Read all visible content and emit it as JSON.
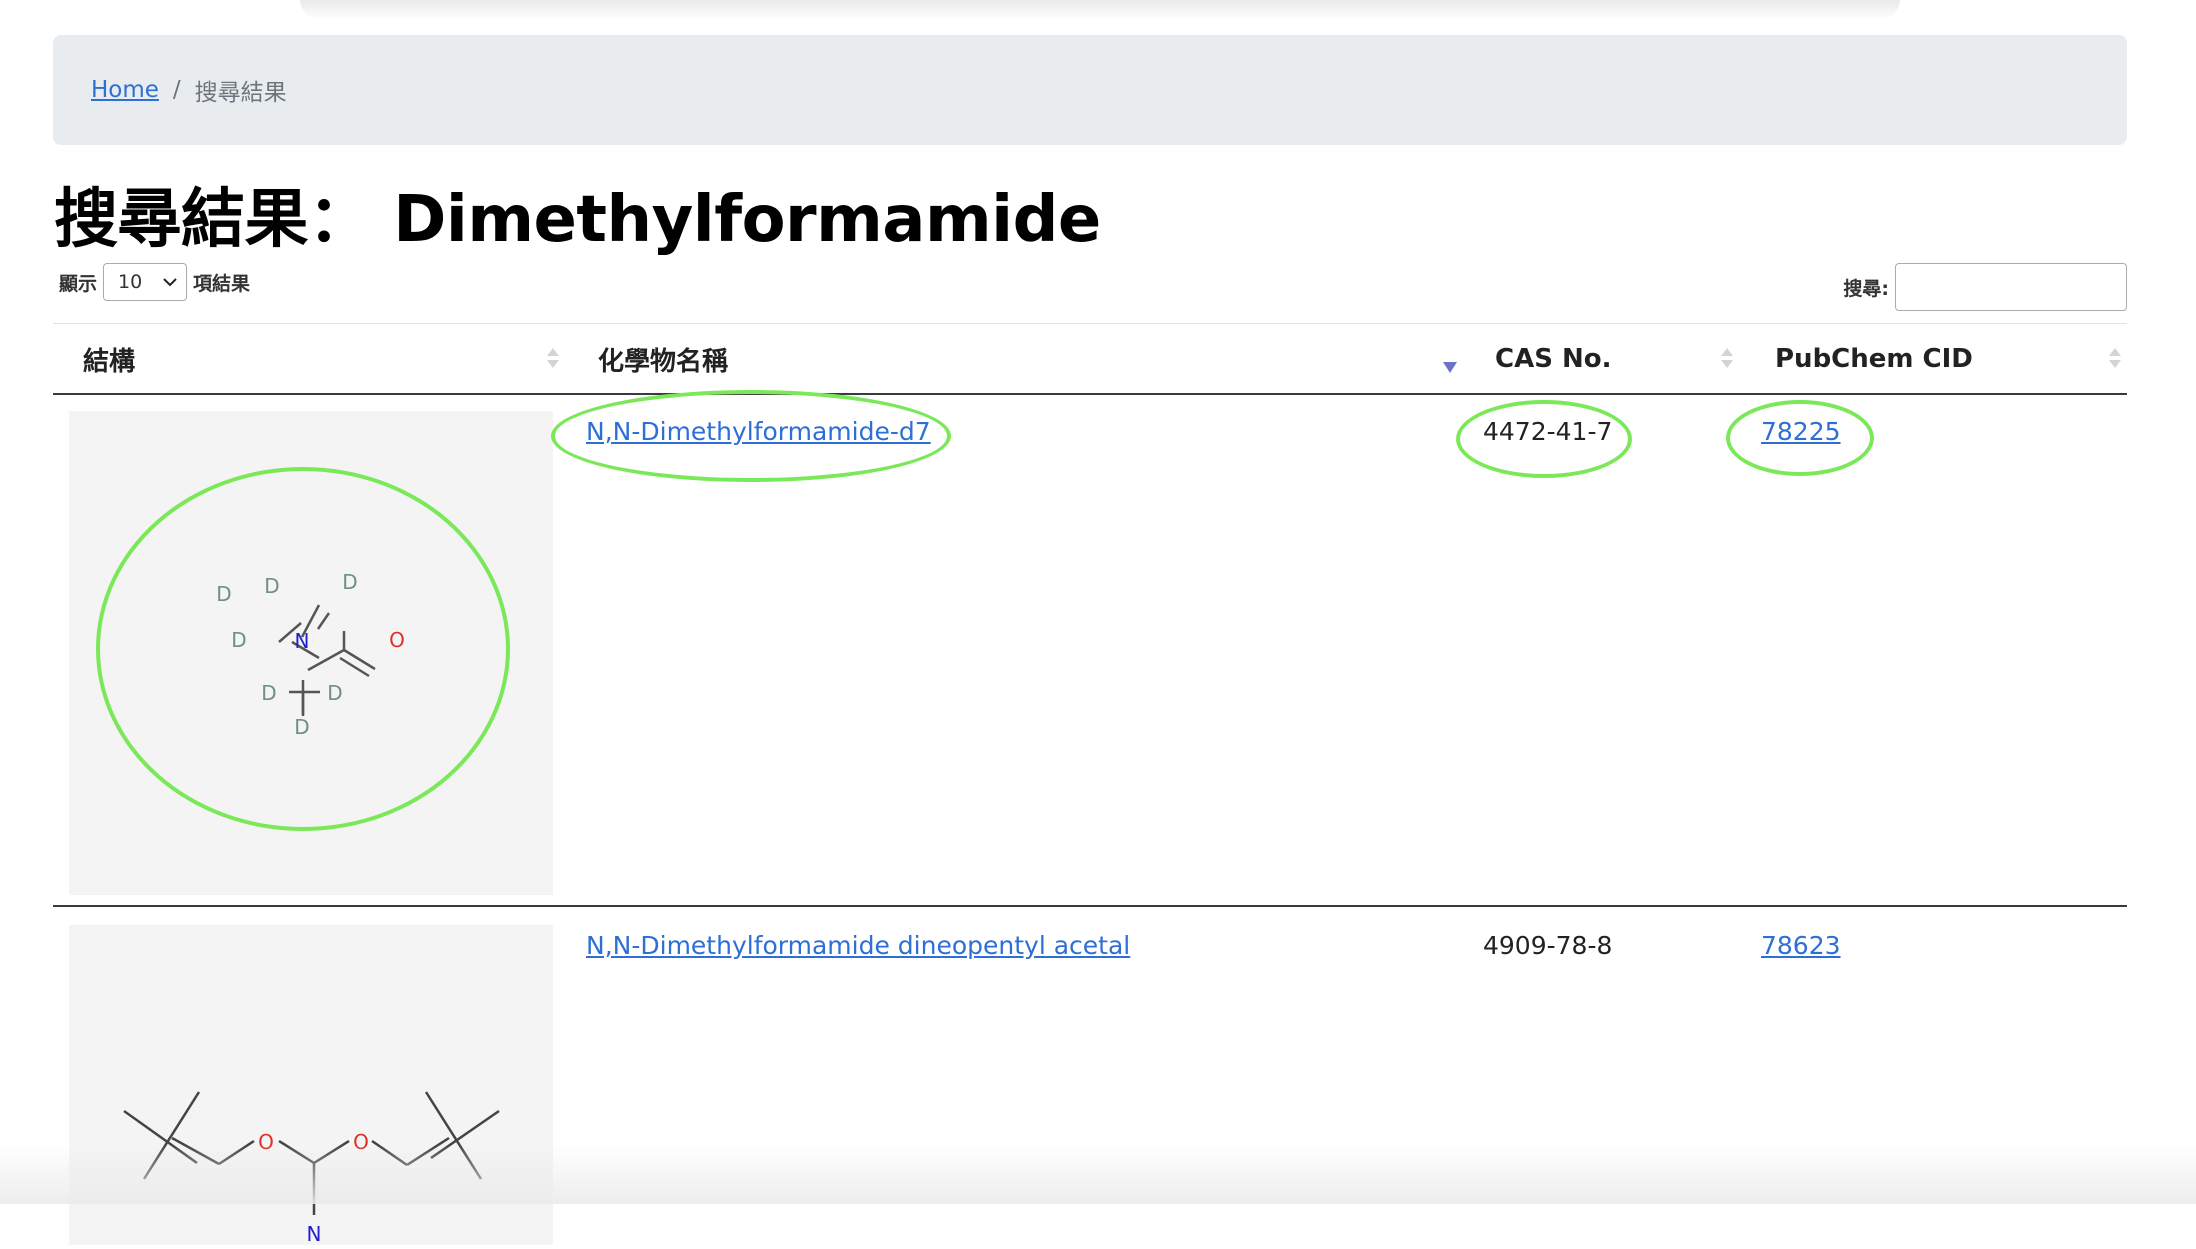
{
  "breadcrumb": {
    "home": "Home",
    "separator": "/",
    "current": "搜尋結果"
  },
  "page_title": "搜尋結果： Dimethylformamide",
  "length_control": {
    "prefix": "顯示",
    "selected": "10",
    "suffix": "項結果"
  },
  "search_control": {
    "label": "搜尋:",
    "value": ""
  },
  "table": {
    "columns": [
      "結構",
      "化學物名稱",
      "CAS No.",
      "PubChem CID"
    ],
    "sorted_column": "化學物名稱",
    "rows": [
      {
        "name": "N,N-Dimethylformamide-d7",
        "cas": "4472-41-7",
        "cid": "78225",
        "structure_atoms": [
          "D",
          "D",
          "D",
          "D",
          "D",
          "D",
          "D",
          "N",
          "O"
        ]
      },
      {
        "name": "N,N-Dimethylformamide dineopentyl acetal",
        "cas": "4909-78-8",
        "cid": "78623",
        "structure_atoms": [
          "O",
          "O",
          "N"
        ]
      }
    ]
  },
  "colors": {
    "link": "#2e6fd6",
    "highlight": "#7be85a",
    "nitrogen": "#2020d0",
    "oxygen": "#e0302a",
    "deuterium": "#6e8f8a"
  }
}
